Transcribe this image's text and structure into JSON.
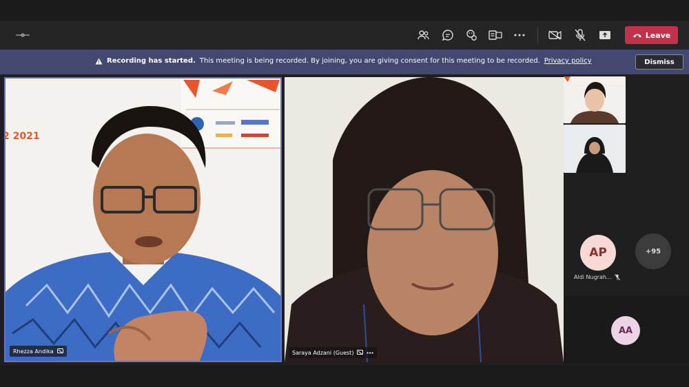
{
  "toolbar": {
    "icons": [
      "people-icon",
      "chat-icon",
      "reactions-icon",
      "share-tray-icon",
      "more-icon",
      "camera-off-icon",
      "mic-off-icon",
      "share-screen-icon"
    ],
    "leave_label": "Leave",
    "leave_color": "#c4314b"
  },
  "banner": {
    "title": "Recording has started.",
    "message": "This meeting is being recorded. By joining, you are giving consent for this meeting to be recorded.",
    "link": "Privacy policy",
    "dismiss_label": "Dismiss",
    "background": "#424870"
  },
  "participants": {
    "main": [
      {
        "name": "Rhezza Andika",
        "highlighted": true
      },
      {
        "name": "Saraya Adzani (Guest)",
        "highlighted": false
      }
    ],
    "slide_text": "2 2021",
    "avatar_ap": {
      "initials": "AP",
      "name": "Aldi Nugrah...",
      "muted": true
    },
    "overflow": "+95",
    "avatar_aa": {
      "initials": "AA"
    }
  }
}
